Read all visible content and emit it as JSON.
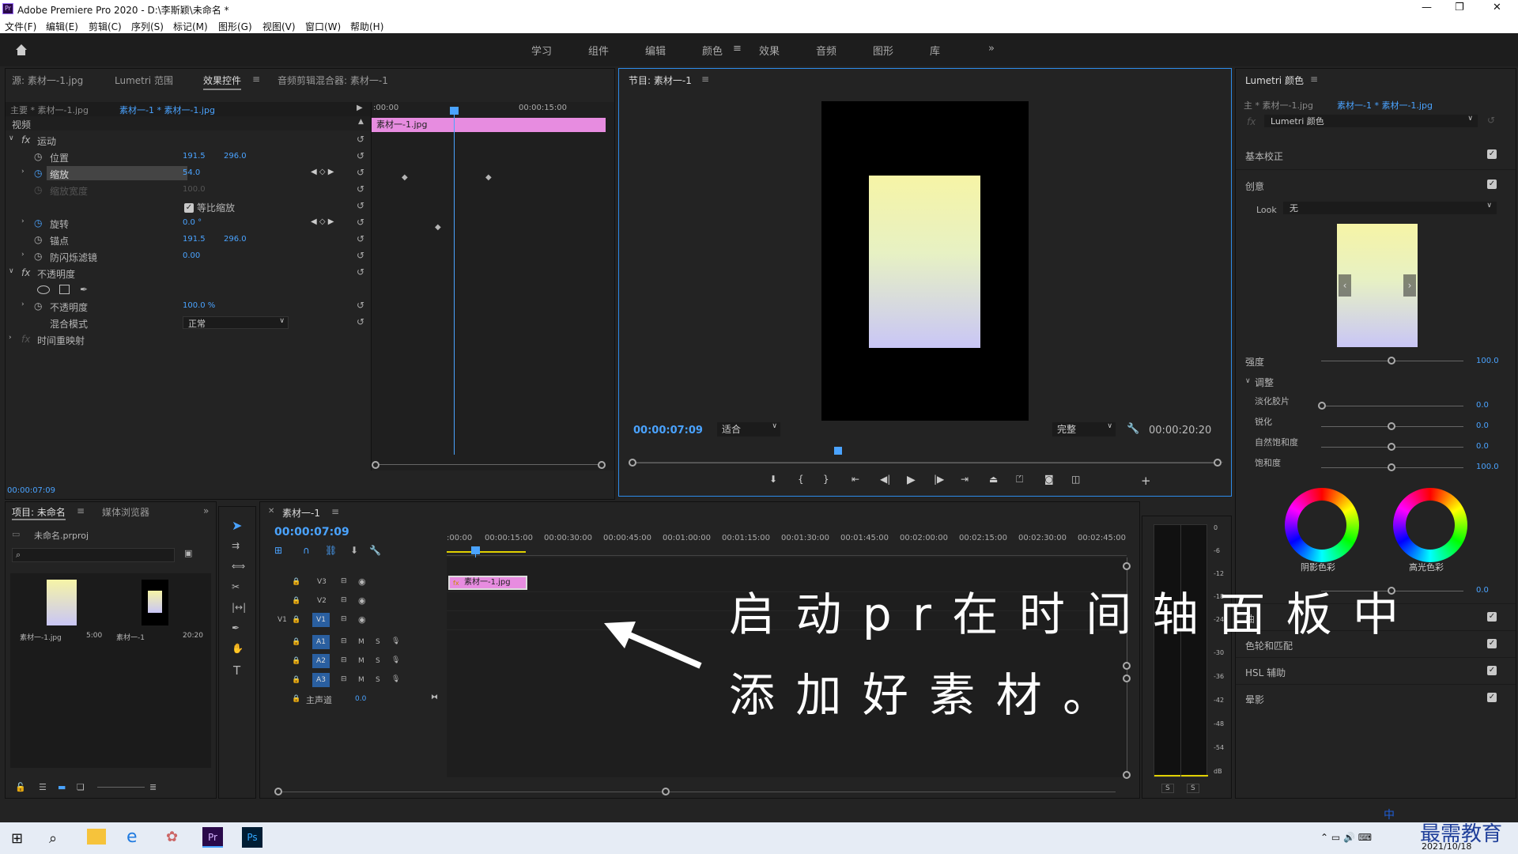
{
  "window": {
    "title": "Adobe Premiere Pro 2020 - D:\\李斯颖\\未命名 *",
    "controls": [
      "—",
      "❐",
      "✕"
    ]
  },
  "menu": [
    "文件(F)",
    "编辑(E)",
    "剪辑(C)",
    "序列(S)",
    "标记(M)",
    "图形(G)",
    "视图(V)",
    "窗口(W)",
    "帮助(H)"
  ],
  "workspaces": [
    "学习",
    "组件",
    "编辑",
    "颜色",
    "效果",
    "音频",
    "图形",
    "库"
  ],
  "active_workspace": "颜色",
  "source_tabs": [
    "源: 素材一-1.jpg",
    "Lumetri 范围",
    "效果控件",
    "音频剪辑混合器: 素材一-1"
  ],
  "effect_controls": {
    "master": "主要 * 素材一-1.jpg",
    "clip": "素材一-1 * 素材一-1.jpg",
    "time_start": ":00:00",
    "time_mid": "00:00:15:00",
    "clip_bar": "素材一-1.jpg",
    "section_video": "视频",
    "motion": "运动",
    "position": {
      "label": "位置",
      "x": "191.5",
      "y": "296.0"
    },
    "scale": {
      "label": "缩放",
      "v": "54.0"
    },
    "scale_width": {
      "label": "缩放宽度",
      "v": "100.0"
    },
    "uniform": "等比缩放",
    "rotation": {
      "label": "旋转",
      "v": "0.0 °"
    },
    "anchor": {
      "label": "锚点",
      "x": "191.5",
      "y": "296.0"
    },
    "flicker": {
      "label": "防闪烁滤镜",
      "v": "0.00"
    },
    "opacity_section": "不透明度",
    "opacity": {
      "label": "不透明度",
      "v": "100.0 %"
    },
    "blend": {
      "label": "混合模式",
      "v": "正常"
    },
    "time_remap": "时间重映射",
    "timecode": "00:00:07:09"
  },
  "program": {
    "tab": "节目: 素材一-1",
    "timecode": "00:00:07:09",
    "fit": "适合",
    "quality": "完整",
    "duration": "00:00:20:20"
  },
  "lumetri": {
    "tab": "Lumetri 颜色",
    "master": "主 * 素材一-1.jpg",
    "clip": "素材一-1 * 素材一-1.jpg",
    "effect": "Lumetri 颜色",
    "basic": "基本校正",
    "creative": "创意",
    "look_label": "Look",
    "look_value": "无",
    "intensity": {
      "label": "强度",
      "v": "100.0"
    },
    "adjust": "调整",
    "faded": {
      "label": "淡化胶片",
      "v": "0.0"
    },
    "sharpen": {
      "label": "锐化",
      "v": "0.0"
    },
    "vibrance": {
      "label": "自然饱和度",
      "v": "0.0"
    },
    "saturation": {
      "label": "饱和度",
      "v": "100.0"
    },
    "shadow": "阴影色彩",
    "highlight": "高光色彩",
    "tint_v": "0.0",
    "curves": "曲",
    "wheels": "色轮和匹配",
    "hsl": "HSL 辅助",
    "vignette": "晕影"
  },
  "project": {
    "tabs": [
      "项目: 未命名",
      "媒体浏览器"
    ],
    "file": "未命名.prproj",
    "items": [
      {
        "name": "素材一-1.jpg",
        "dur": "5:00"
      },
      {
        "name": "素材一-1",
        "dur": "20:20"
      }
    ]
  },
  "timeline": {
    "tab": "素材一-1",
    "timecode": "00:00:07:09",
    "ruler": [
      ":00:00",
      "00:00:15:00",
      "00:00:30:00",
      "00:00:45:00",
      "00:01:00:00",
      "00:01:15:00",
      "00:01:30:00",
      "00:01:45:00",
      "00:02:00:00",
      "00:02:15:00",
      "00:02:30:00",
      "00:02:45:00"
    ],
    "video_tracks": [
      "V3",
      "V2",
      "V1"
    ],
    "audio_tracks": [
      "A1",
      "A2",
      "A3"
    ],
    "master": "主声道",
    "master_v": "0.0",
    "src_v1": "V1",
    "clip": "素材一-1.jpg"
  },
  "meter": [
    "0",
    "-6",
    "-12",
    "-18",
    "-24",
    "-30",
    "-36",
    "-42",
    "-48",
    "-54",
    "dB"
  ],
  "overlay": {
    "line1": "启 动 p r 在 时 间 轴 面 板 中",
    "line2": "添 加 好 素 材 。"
  },
  "taskbar": {
    "date": "2021/10/18",
    "watermark": "最需教育",
    "ime": "中"
  }
}
